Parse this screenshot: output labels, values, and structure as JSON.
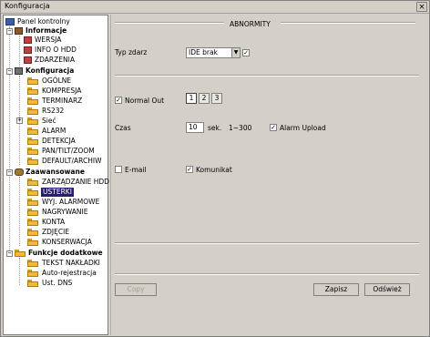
{
  "window": {
    "title": "Konfiguracja",
    "close_glyph": "×"
  },
  "tree": {
    "root": "Panel kontrolny",
    "informacje": {
      "label": "Informacje",
      "items": [
        "WERSJA",
        "INFO O HDD",
        "ZDARZENIA"
      ]
    },
    "konfiguracja": {
      "label": "Konfiguracja",
      "items": [
        "OGÓLNE",
        "KOMPRESJA",
        "TERMINARZ",
        "RS232",
        "Sieć",
        "ALARM",
        "DETEKCJA",
        "PAN/TILT/ZOOM",
        "DEFAULT/ARCHIW"
      ]
    },
    "zaawansowane": {
      "label": "Zaawansowane",
      "items": [
        "ZARZĄDZANIE HDD",
        "USTERKI",
        "WYJ. ALARMOWE",
        "NAGRYWANIE",
        "KONTA",
        "ZDJĘCIE",
        "KONSERWACJA"
      ]
    },
    "funkcje": {
      "label": "Funkcje dodatkowe",
      "items": [
        "TEKST NAKŁADKI",
        "Auto-rejestracja",
        "Ust. DNS"
      ]
    }
  },
  "panel": {
    "title": "ABNORMITY",
    "event_type_label": "Typ zdarz",
    "event_type_value": "IDE brak",
    "event_enabled": true,
    "normal_out_label": "Normal Out",
    "normal_out_checked": true,
    "outputs": [
      "1",
      "2",
      "3"
    ],
    "active_output": "1",
    "time_label": "Czas",
    "time_value": "10",
    "time_unit": "sek.",
    "time_range": "1~300",
    "alarm_upload_label": "Alarm Upload",
    "alarm_upload_checked": true,
    "email_label": "E-mail",
    "email_checked": false,
    "message_label": "Komunikat",
    "message_checked": true
  },
  "buttons": {
    "copy": "Copy",
    "save": "Zapisz",
    "refresh": "Odśwież"
  }
}
